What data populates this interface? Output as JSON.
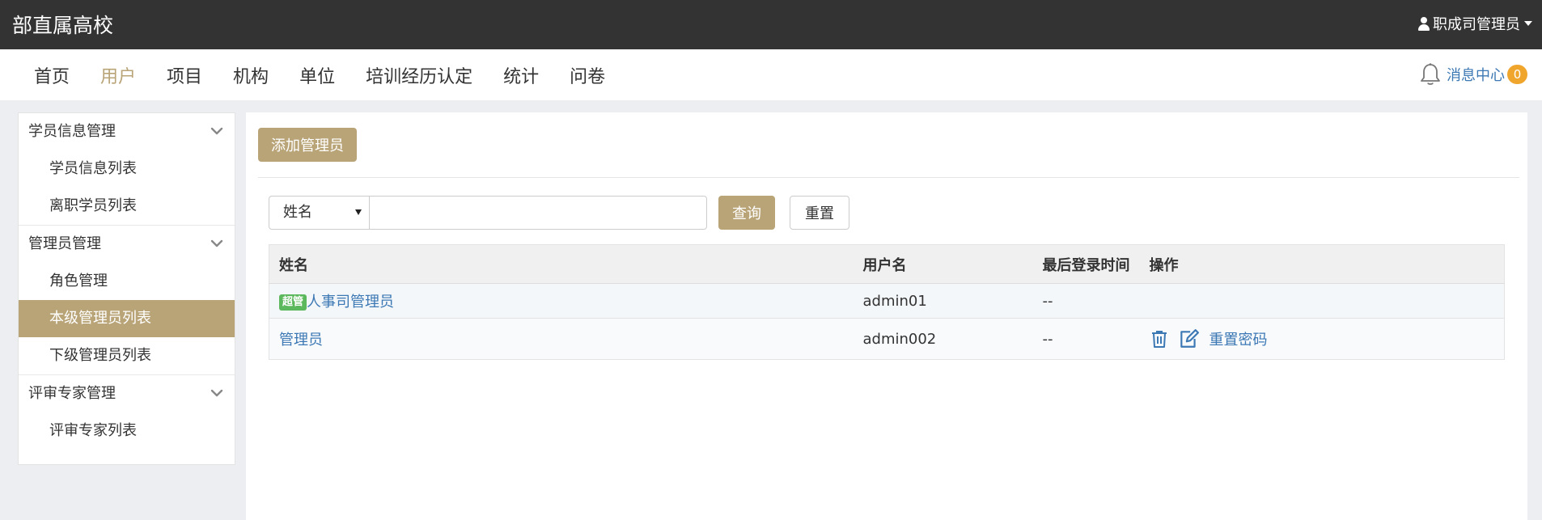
{
  "header": {
    "brand": "部直属高校",
    "user_label": "职成司管理员"
  },
  "nav": {
    "items": [
      {
        "label": "首页",
        "active": false
      },
      {
        "label": "用户",
        "active": true
      },
      {
        "label": "项目",
        "active": false
      },
      {
        "label": "机构",
        "active": false
      },
      {
        "label": "单位",
        "active": false
      },
      {
        "label": "培训经历认定",
        "active": false
      },
      {
        "label": "统计",
        "active": false
      },
      {
        "label": "问卷",
        "active": false
      }
    ],
    "message_center": "消息中心",
    "message_count": "0"
  },
  "sidebar": {
    "groups": [
      {
        "title": "学员信息管理",
        "items": [
          "学员信息列表",
          "离职学员列表"
        ]
      },
      {
        "title": "管理员管理",
        "items": [
          "角色管理",
          "本级管理员列表",
          "下级管理员列表"
        ]
      },
      {
        "title": "评审专家管理",
        "items": [
          "评审专家列表"
        ]
      }
    ],
    "active_item": "本级管理员列表"
  },
  "main": {
    "add_button": "添加管理员",
    "search": {
      "field_selected": "姓名",
      "input_value": "",
      "query_button": "查询",
      "reset_button": "重置"
    },
    "table": {
      "headers": [
        "姓名",
        "用户名",
        "最后登录时间",
        "操作"
      ],
      "rows": [
        {
          "tag": "超管",
          "name": "人事司管理员",
          "username": "admin01",
          "last_login": "--",
          "reset_pwd": ""
        },
        {
          "tag": "",
          "name": "管理员",
          "username": "admin002",
          "last_login": "--",
          "reset_pwd": "重置密码"
        }
      ]
    }
  },
  "colors": {
    "accent": "#b9a478",
    "topbar": "#333333",
    "link": "#3c78b4",
    "badge": "#f0a52d",
    "tag": "#5cb85c"
  },
  "icons": {
    "user": "person-icon",
    "bell": "bell-icon",
    "chevron": "chevron-down-icon",
    "delete": "trash-icon",
    "edit": "edit-icon"
  }
}
